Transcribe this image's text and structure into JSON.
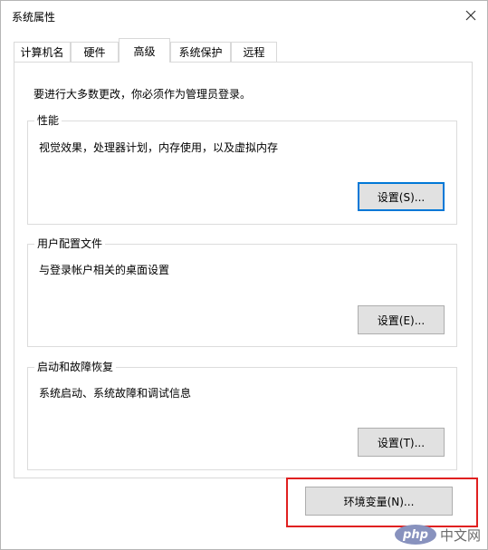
{
  "window": {
    "title": "系统属性"
  },
  "tabs": [
    {
      "label": "计算机名"
    },
    {
      "label": "硬件"
    },
    {
      "label": "高级",
      "active": true
    },
    {
      "label": "系统保护"
    },
    {
      "label": "远程"
    }
  ],
  "advanced": {
    "notice": "要进行大多数更改，你必须作为管理员登录。",
    "performance": {
      "title": "性能",
      "description": "视觉效果，处理器计划，内存使用，以及虚拟内存",
      "button": "设置(S)..."
    },
    "user_profiles": {
      "title": "用户配置文件",
      "description": "与登录帐户相关的桌面设置",
      "button": "设置(E)..."
    },
    "startup_recovery": {
      "title": "启动和故障恢复",
      "description": "系统启动、系统故障和调试信息",
      "button": "设置(T)..."
    },
    "env_button": "环境变量(N)..."
  },
  "watermark": {
    "logo": "php",
    "text": "中文网"
  },
  "colors": {
    "highlight": "#e02020",
    "focus": "#0078d7"
  }
}
